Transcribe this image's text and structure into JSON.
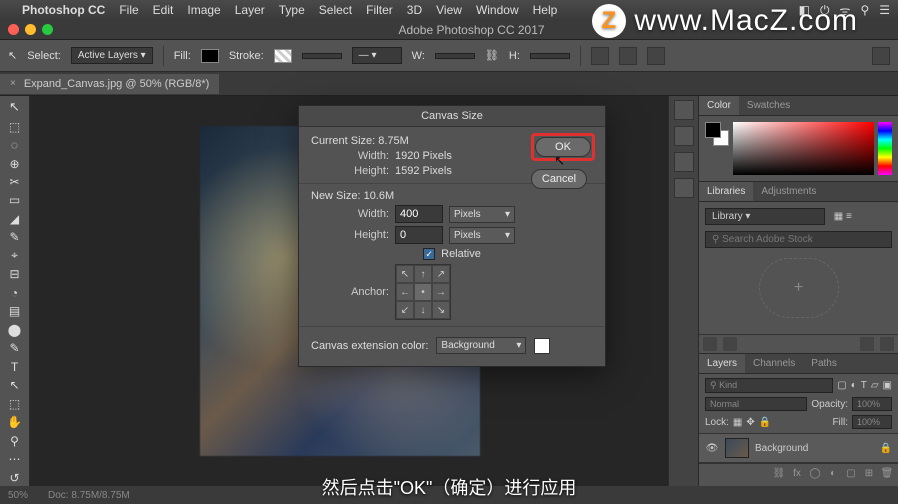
{
  "menubar": {
    "apple": "",
    "app": "Photoshop CC",
    "items": [
      "File",
      "Edit",
      "Image",
      "Layer",
      "Type",
      "Select",
      "Filter",
      "3D",
      "View",
      "Window",
      "Help"
    ],
    "status_glyphs": [
      "◧",
      "⏻",
      "ᯤ",
      "⚲",
      "☰"
    ]
  },
  "window": {
    "title": "Adobe Photoshop CC 2017"
  },
  "options": {
    "select_label": "Select:",
    "select_value": "Active Layers",
    "fill_label": "Fill:",
    "stroke_label": "Stroke:",
    "w_label": "W:",
    "h_label": "H:"
  },
  "tab": {
    "label": "Expand_Canvas.jpg @ 50% (RGB/8*)"
  },
  "tools": [
    "↖",
    "⬚",
    "◌",
    "⊕",
    "✂",
    "▭",
    "◢",
    "✎",
    "⌖",
    "⊟",
    "◔",
    "▤",
    "⬤",
    "✎",
    "T",
    "↖",
    "⬚",
    "✋",
    "⚲",
    "⋯",
    "◧",
    "↺"
  ],
  "dialog": {
    "title": "Canvas Size",
    "ok": "OK",
    "cancel": "Cancel",
    "current_label": "Current Size: 8.75M",
    "cur_width_label": "Width:",
    "cur_width_value": "1920 Pixels",
    "cur_height_label": "Height:",
    "cur_height_value": "1592 Pixels",
    "new_label": "New Size: 10.6M",
    "new_width_label": "Width:",
    "new_width_value": "400",
    "new_width_unit": "Pixels",
    "new_height_label": "Height:",
    "new_height_value": "0",
    "new_height_unit": "Pixels",
    "relative_label": "Relative",
    "anchor_label": "Anchor:",
    "ext_label": "Canvas extension color:",
    "ext_value": "Background"
  },
  "panels": {
    "color_tab": "Color",
    "swatches_tab": "Swatches",
    "libraries_tab": "Libraries",
    "adjustments_tab": "Adjustments",
    "library_label": "Library",
    "search_placeholder": "Search Adobe Stock",
    "layers_tab": "Layers",
    "channels_tab": "Channels",
    "paths_tab": "Paths",
    "kind_label": "Kind",
    "blend_mode": "Normal",
    "opacity_label": "Opacity:",
    "opacity_value": "100%",
    "lock_label": "Lock:",
    "fill_label": "Fill:",
    "fill_value": "100%",
    "layer_name": "Background"
  },
  "status": {
    "zoom": "50%",
    "doc": "Doc: 8.75M/8.75M"
  },
  "watermark": {
    "logo": "Z",
    "text": "www.MacZ.com"
  },
  "subtitle": "然后点击\"OK\"（确定）进行应用"
}
